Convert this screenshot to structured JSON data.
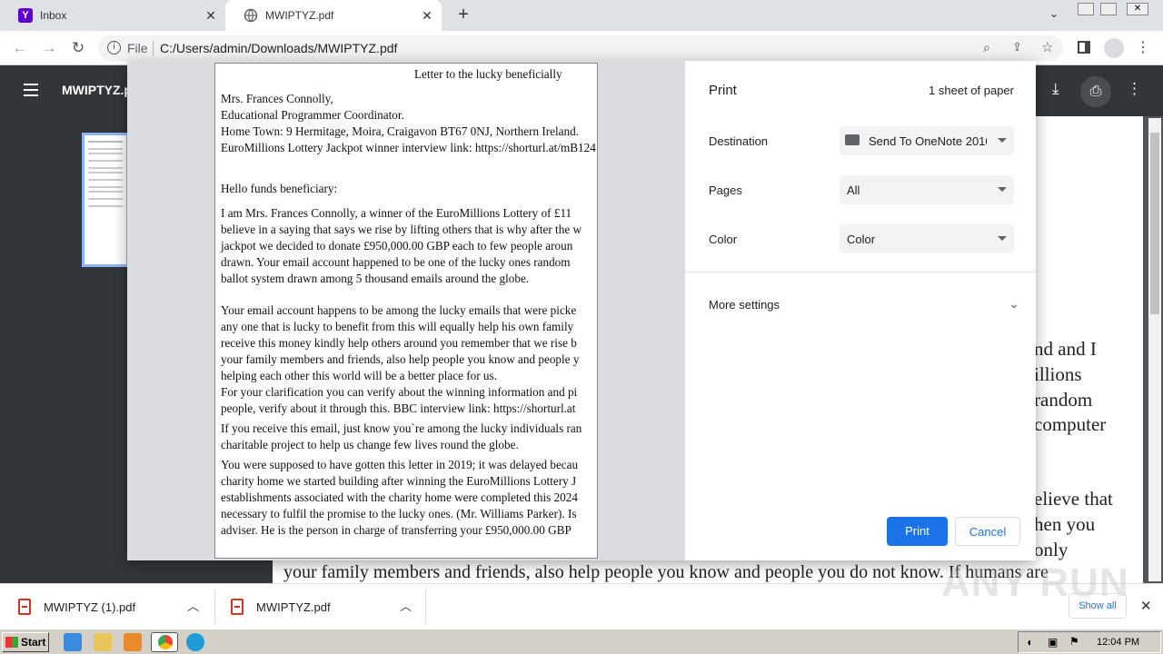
{
  "tabs": [
    {
      "title": "Inbox"
    },
    {
      "title": "MWIPTYZ.pdf"
    }
  ],
  "address": {
    "scheme_label": "File",
    "url": "C:/Users/admin/Downloads/MWIPTYZ.pdf"
  },
  "pdf_viewer": {
    "title": "MWIPTYZ.p"
  },
  "background_page": {
    "lines": [
      "nd and I",
      "illions",
      "random",
      "computer",
      "elieve that",
      "hen you",
      "only"
    ],
    "bottom_line": "your family members and friends, also help people you know and people you do not know. If humans are"
  },
  "print_dialog": {
    "title": "Print",
    "sheets": "1 sheet of paper",
    "destination_label": "Destination",
    "destination_value": "Send To OneNote 2010",
    "pages_label": "Pages",
    "pages_value": "All",
    "color_label": "Color",
    "color_value": "Color",
    "more_settings": "More settings",
    "print_button": "Print",
    "cancel_button": "Cancel"
  },
  "preview_letter": {
    "heading": "Letter to the lucky beneficially",
    "lines_a": [
      "Mrs. Frances Connolly,",
      "Educational Programmer Coordinator.",
      "Home Town: 9 Hermitage, Moira, Craigavon BT67 0NJ, Northern Ireland.",
      "EuroMillions Lottery Jackpot winner interview link: https://shorturl.at/mB124"
    ],
    "greeting": "Hello funds beneficiary:",
    "para1": [
      "I am Mrs. Frances Connolly, a winner of the EuroMillions Lottery of £11",
      "believe in a saying that says we rise by lifting others that is why after the w",
      "jackpot we decided to donate £950,000.00 GBP each to few people aroun",
      "drawn. Your email account happened to be one of the lucky ones random",
      "ballot system drawn among 5 thousand emails around the globe."
    ],
    "para2": [
      "Your email account happens to be among the lucky emails that were picke",
      "any one that is lucky to benefit from this will equally help his own family",
      "receive this money kindly help others around you remember that we rise b",
      "your family members and friends, also help people you know and people y",
      "helping each other this world will be a better place for us.",
      "For your clarification you can verify about the winning information and pi",
      "people, verify about it through this.  BBC interview link: https://shorturl.at"
    ],
    "para3": [
      "If you receive this email, just know you`re among the lucky individuals ran",
      "charitable project to help us change few lives round the globe."
    ],
    "para4": [
      "You were supposed to have gotten this letter in 2019; it was delayed becau",
      "charity home we started building after winning the EuroMillions Lottery J",
      "establishments associated with the charity home were completed this 2024",
      "necessary to fulfil the promise to the lucky ones. (Mr. Williams Parker). Is",
      "adviser. He is the person in charge of transferring your £950,000.00 GBP"
    ]
  },
  "downloads": [
    {
      "name": "MWIPTYZ (1).pdf"
    },
    {
      "name": "MWIPTYZ.pdf"
    }
  ],
  "show_all": "Show all",
  "taskbar": {
    "start": "Start",
    "clock": "12:04 PM"
  },
  "watermark": "ANY RUN"
}
